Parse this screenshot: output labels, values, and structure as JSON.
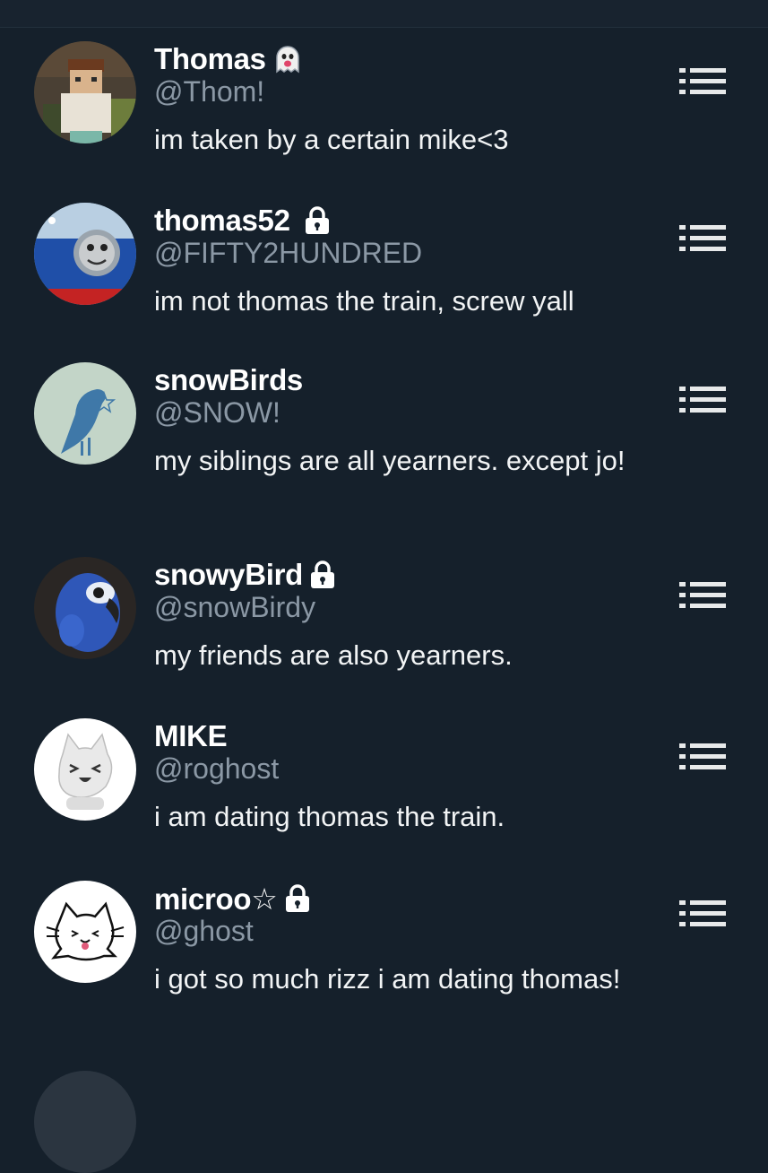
{
  "users": [
    {
      "name": "Thomas",
      "badge": "ghost-emoji",
      "handle": "@Thom!",
      "bio": "im taken by a certain mike<3",
      "avatar": "minecraft-skin-avatar"
    },
    {
      "name": "thomas52",
      "badge": "lock-icon",
      "handle": "@FIFTY2HUNDRED",
      "bio": "im not thomas the train, screw yall",
      "avatar": "thomas-train-avatar"
    },
    {
      "name": "snowBirds",
      "badge": "",
      "handle": "@SNOW!",
      "bio": "my siblings are all yearners. except jo!",
      "avatar": "bird-silhouette-avatar"
    },
    {
      "name": "snowyBird",
      "badge": "lock-icon",
      "handle": "@snowBirdy",
      "bio": "my friends are also yearners.",
      "avatar": "blue-parrot-avatar"
    },
    {
      "name": "MIKE",
      "badge": "",
      "handle": "@roghost",
      "bio": "i am dating thomas the train.",
      "avatar": "white-cat-avatar"
    },
    {
      "name": "microo☆",
      "badge": "lock-icon",
      "handle": "@ghost",
      "bio": "i got so much rizz i am dating thomas!",
      "avatar": "cat-sketch-avatar"
    }
  ],
  "colors": {
    "background": "#15202b",
    "text": "#ffffff",
    "secondary_text": "#8b98a5",
    "icon": "#e7e9ea"
  },
  "icons": {
    "row_menu": "list-menu-icon"
  }
}
